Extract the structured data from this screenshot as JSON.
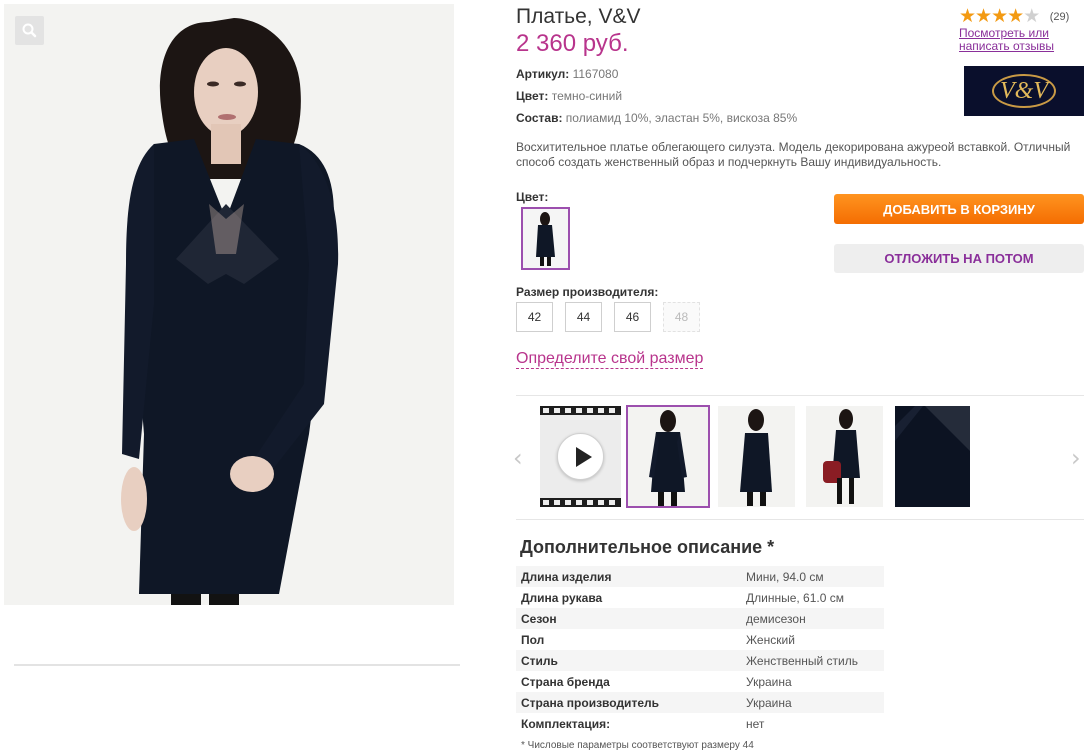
{
  "product": {
    "title": "Платье, V&V",
    "price": "2 360 руб.",
    "rating": {
      "stars_filled": 4,
      "stars_total": 5,
      "count": "(29)",
      "reviews_link": "Посмотреть или написать отзывы"
    },
    "brand_logo_text": "V&V",
    "attributes": [
      {
        "label": "Артикул:",
        "value": "1167080"
      },
      {
        "label": "Цвет:",
        "value": "темно-синий"
      },
      {
        "label": "Состав:",
        "value": "полиамид 10%, эластан 5%, вискоза 85%"
      }
    ],
    "description": "Восхитительное платье облегающего силуэта. Модель декорирована ажуреой вставкой. Отличный способ создать женственный образ и подчеркнуть Вашу индивидуальность."
  },
  "color_section": {
    "label": "Цвет:"
  },
  "buttons": {
    "add_to_cart": "ДОБАВИТЬ В КОРЗИНУ",
    "save_for_later": "ОТЛОЖИТЬ НА ПОТОМ"
  },
  "sizes": {
    "label": "Размер производителя:",
    "options": [
      {
        "value": "42",
        "available": true
      },
      {
        "value": "44",
        "available": true
      },
      {
        "value": "46",
        "available": true
      },
      {
        "value": "48",
        "available": false
      }
    ],
    "guide_link": "Определите свой размер"
  },
  "gallery": {
    "icons": {
      "prev": "chevron-left-icon",
      "next": "chevron-right-icon",
      "video": "play-icon",
      "zoom": "magnifier-icon"
    },
    "selected_index": 1
  },
  "additional": {
    "title": "Дополнительное описание *",
    "rows": [
      {
        "key": "Длина изделия",
        "value": "Мини, 94.0 см"
      },
      {
        "key": "Длина рукава",
        "value": "Длинные, 61.0 см"
      },
      {
        "key": "Сезон",
        "value": "демисезон"
      },
      {
        "key": "Пол",
        "value": "Женский"
      },
      {
        "key": "Стиль",
        "value": "Женственный стиль"
      },
      {
        "key": "Страна бренда",
        "value": "Украина"
      },
      {
        "key": "Страна производитель",
        "value": "Украина"
      },
      {
        "key": "Комплектация:",
        "value": "нет"
      }
    ],
    "footnote": "* Числовые параметры соответствуют размеру 44"
  },
  "colors": {
    "accent": "#b8348c",
    "link": "#8a2f9a",
    "cta": "#f46d02",
    "dress": "#0f1726"
  }
}
